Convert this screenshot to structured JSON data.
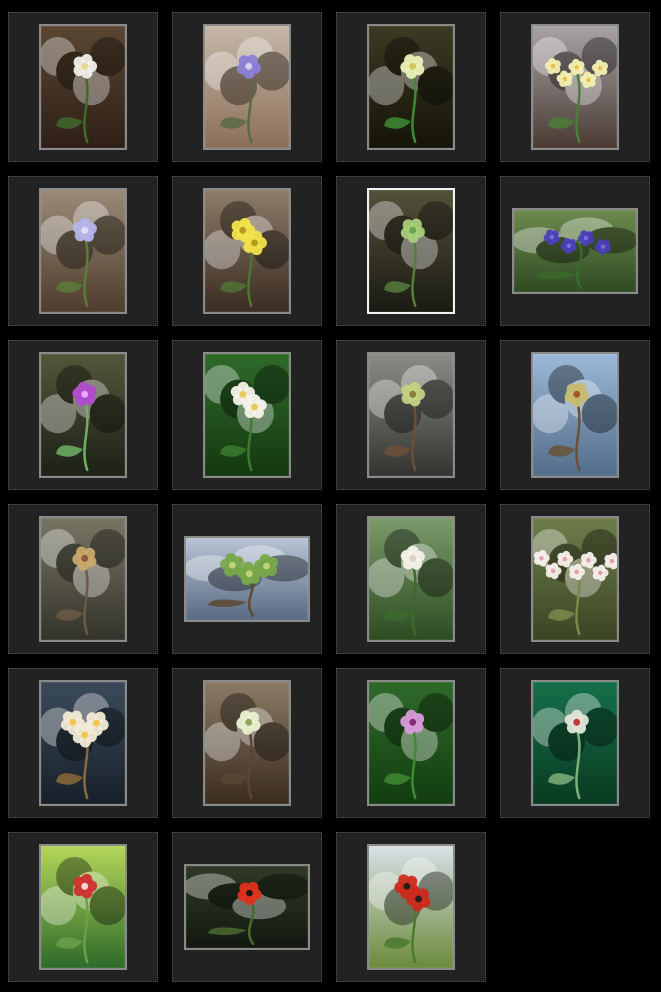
{
  "gallery": {
    "columns": 4,
    "selected_index": 6,
    "thumbnails": [
      {
        "id": "anemone-white",
        "orientation": "portrait",
        "bg": [
          "#5a4632",
          "#2e1f16"
        ],
        "stem": "#3f6a2a",
        "flower": "#f1efe8",
        "center": "#e9d88a",
        "flower_count": 1
      },
      {
        "id": "hepatica-blue",
        "orientation": "portrait",
        "bg": [
          "#c5b8a8",
          "#8c6e58"
        ],
        "stem": "#5b6a44",
        "flower": "#8a7fd6",
        "center": "#d6d0f0",
        "flower_count": 1
      },
      {
        "id": "primrose-moss",
        "orientation": "portrait",
        "bg": [
          "#3c3a22",
          "#151408"
        ],
        "stem": "#3f8a35",
        "flower": "#e9f0b5",
        "center": "#d1c75a",
        "flower_count": 1
      },
      {
        "id": "primrose-cluster",
        "orientation": "portrait",
        "bg": [
          "#a7a2a5",
          "#4a3b33"
        ],
        "stem": "#4d7d3a",
        "flower": "#f3efb2",
        "center": "#e5c34c",
        "flower_count": 5
      },
      {
        "id": "anemone-lilac",
        "orientation": "portrait",
        "bg": [
          "#9b8a77",
          "#4e3c2c"
        ],
        "stem": "#5a7b3a",
        "flower": "#b5b5ea",
        "center": "#e0e0f6",
        "flower_count": 1
      },
      {
        "id": "yellow-violet",
        "orientation": "portrait",
        "bg": [
          "#8e7b68",
          "#3a2c22"
        ],
        "stem": "#4f7332",
        "flower": "#f2e14a",
        "center": "#b59a1f",
        "flower_count": 2
      },
      {
        "id": "moss-stump",
        "orientation": "portrait",
        "bg": [
          "#54513a",
          "#1a1a12"
        ],
        "stem": "#567c3e",
        "flower": "#a9cf7a",
        "center": "#6aa24e",
        "flower_count": 1
      },
      {
        "id": "lungwort-blue",
        "orientation": "landscape",
        "bg": [
          "#6d8a4f",
          "#2f4b22"
        ],
        "stem": "#3c6a2b",
        "flower": "#4b3fb8",
        "center": "#7b70d8",
        "flower_count": 4
      },
      {
        "id": "pink-wildflower",
        "orientation": "portrait",
        "bg": [
          "#54563a",
          "#1c2016"
        ],
        "stem": "#6fb066",
        "flower": "#b04bd0",
        "center": "#f0a5ff",
        "flower_count": 1
      },
      {
        "id": "wood-anemone-pair",
        "orientation": "portrait",
        "bg": [
          "#2f6a2a",
          "#143810"
        ],
        "stem": "#3c7a2e",
        "flower": "#f4f2ea",
        "center": "#e9c957",
        "flower_count": 2
      },
      {
        "id": "chestnut-bud-grey",
        "orientation": "portrait",
        "bg": [
          "#8a8d86",
          "#33342f"
        ],
        "stem": "#6b5038",
        "flower": "#c4d27f",
        "center": "#8a7d3a",
        "flower_count": 1
      },
      {
        "id": "chestnut-bud-sky",
        "orientation": "portrait",
        "bg": [
          "#9bb8d8",
          "#536d8a"
        ],
        "stem": "#6a5238",
        "flower": "#c8bb6f",
        "center": "#a0572d",
        "flower_count": 1
      },
      {
        "id": "bare-twigs",
        "orientation": "portrait",
        "bg": [
          "#777562",
          "#34332b"
        ],
        "stem": "#6b5a44",
        "flower": "#c8a86a",
        "center": "#8a5a3a",
        "flower_count": 1
      },
      {
        "id": "chestnut-leaves",
        "orientation": "landscape",
        "bg": [
          "#b7c4d6",
          "#5a6a82"
        ],
        "stem": "#5d4a34",
        "flower": "#78a84a",
        "center": "#c4d27a",
        "flower_count": 3
      },
      {
        "id": "chestnut-candle",
        "orientation": "portrait",
        "bg": [
          "#7a9a6a",
          "#2d4c22"
        ],
        "stem": "#3d6a2c",
        "flower": "#f4f1ea",
        "center": "#d9d3c4",
        "flower_count": 1
      },
      {
        "id": "blossom-closeup",
        "orientation": "portrait",
        "bg": [
          "#6f7d4a",
          "#3b4424"
        ],
        "stem": "#7a8a4a",
        "flower": "#f6f0ea",
        "center": "#e3a0a8",
        "flower_count": 7
      },
      {
        "id": "chestnut-flower-macro",
        "orientation": "portrait",
        "bg": [
          "#3b4a5a",
          "#16202a"
        ],
        "stem": "#8a6a3a",
        "flower": "#f2ead6",
        "center": "#f0c84a",
        "flower_count": 3
      },
      {
        "id": "vine-sprout",
        "orientation": "portrait",
        "bg": [
          "#8a7a64",
          "#3a2c20"
        ],
        "stem": "#5a4632",
        "flower": "#e9f0d2",
        "center": "#8aaa5a",
        "flower_count": 1
      },
      {
        "id": "pink-star-flower",
        "orientation": "portrait",
        "bg": [
          "#2f6a2a",
          "#123d10"
        ],
        "stem": "#3f8a32",
        "flower": "#d89ad8",
        "center": "#8a2a7a",
        "flower_count": 1
      },
      {
        "id": "poppy-bud",
        "orientation": "portrait",
        "bg": [
          "#16704a",
          "#0a3a22"
        ],
        "stem": "#7fb07a",
        "flower": "#dfe6d8",
        "center": "#c43a3a",
        "flower_count": 1
      },
      {
        "id": "poppy-bud-curl",
        "orientation": "portrait",
        "bg": [
          "#b3d65a",
          "#2f6a2a"
        ],
        "stem": "#6aa04a",
        "flower": "#d03030",
        "center": "#f2d7d7",
        "flower_count": 1
      },
      {
        "id": "red-poppy",
        "orientation": "landscape",
        "bg": [
          "#2f3a26",
          "#121810"
        ],
        "stem": "#4a6a2e",
        "flower": "#e0301e",
        "center": "#1d1b16",
        "flower_count": 1
      },
      {
        "id": "poppies-field",
        "orientation": "portrait",
        "bg": [
          "#d8e0e6",
          "#6b8a3a"
        ],
        "stem": "#4a7a2e",
        "flower": "#cf2a1e",
        "center": "#2a1d16",
        "flower_count": 2
      }
    ]
  }
}
